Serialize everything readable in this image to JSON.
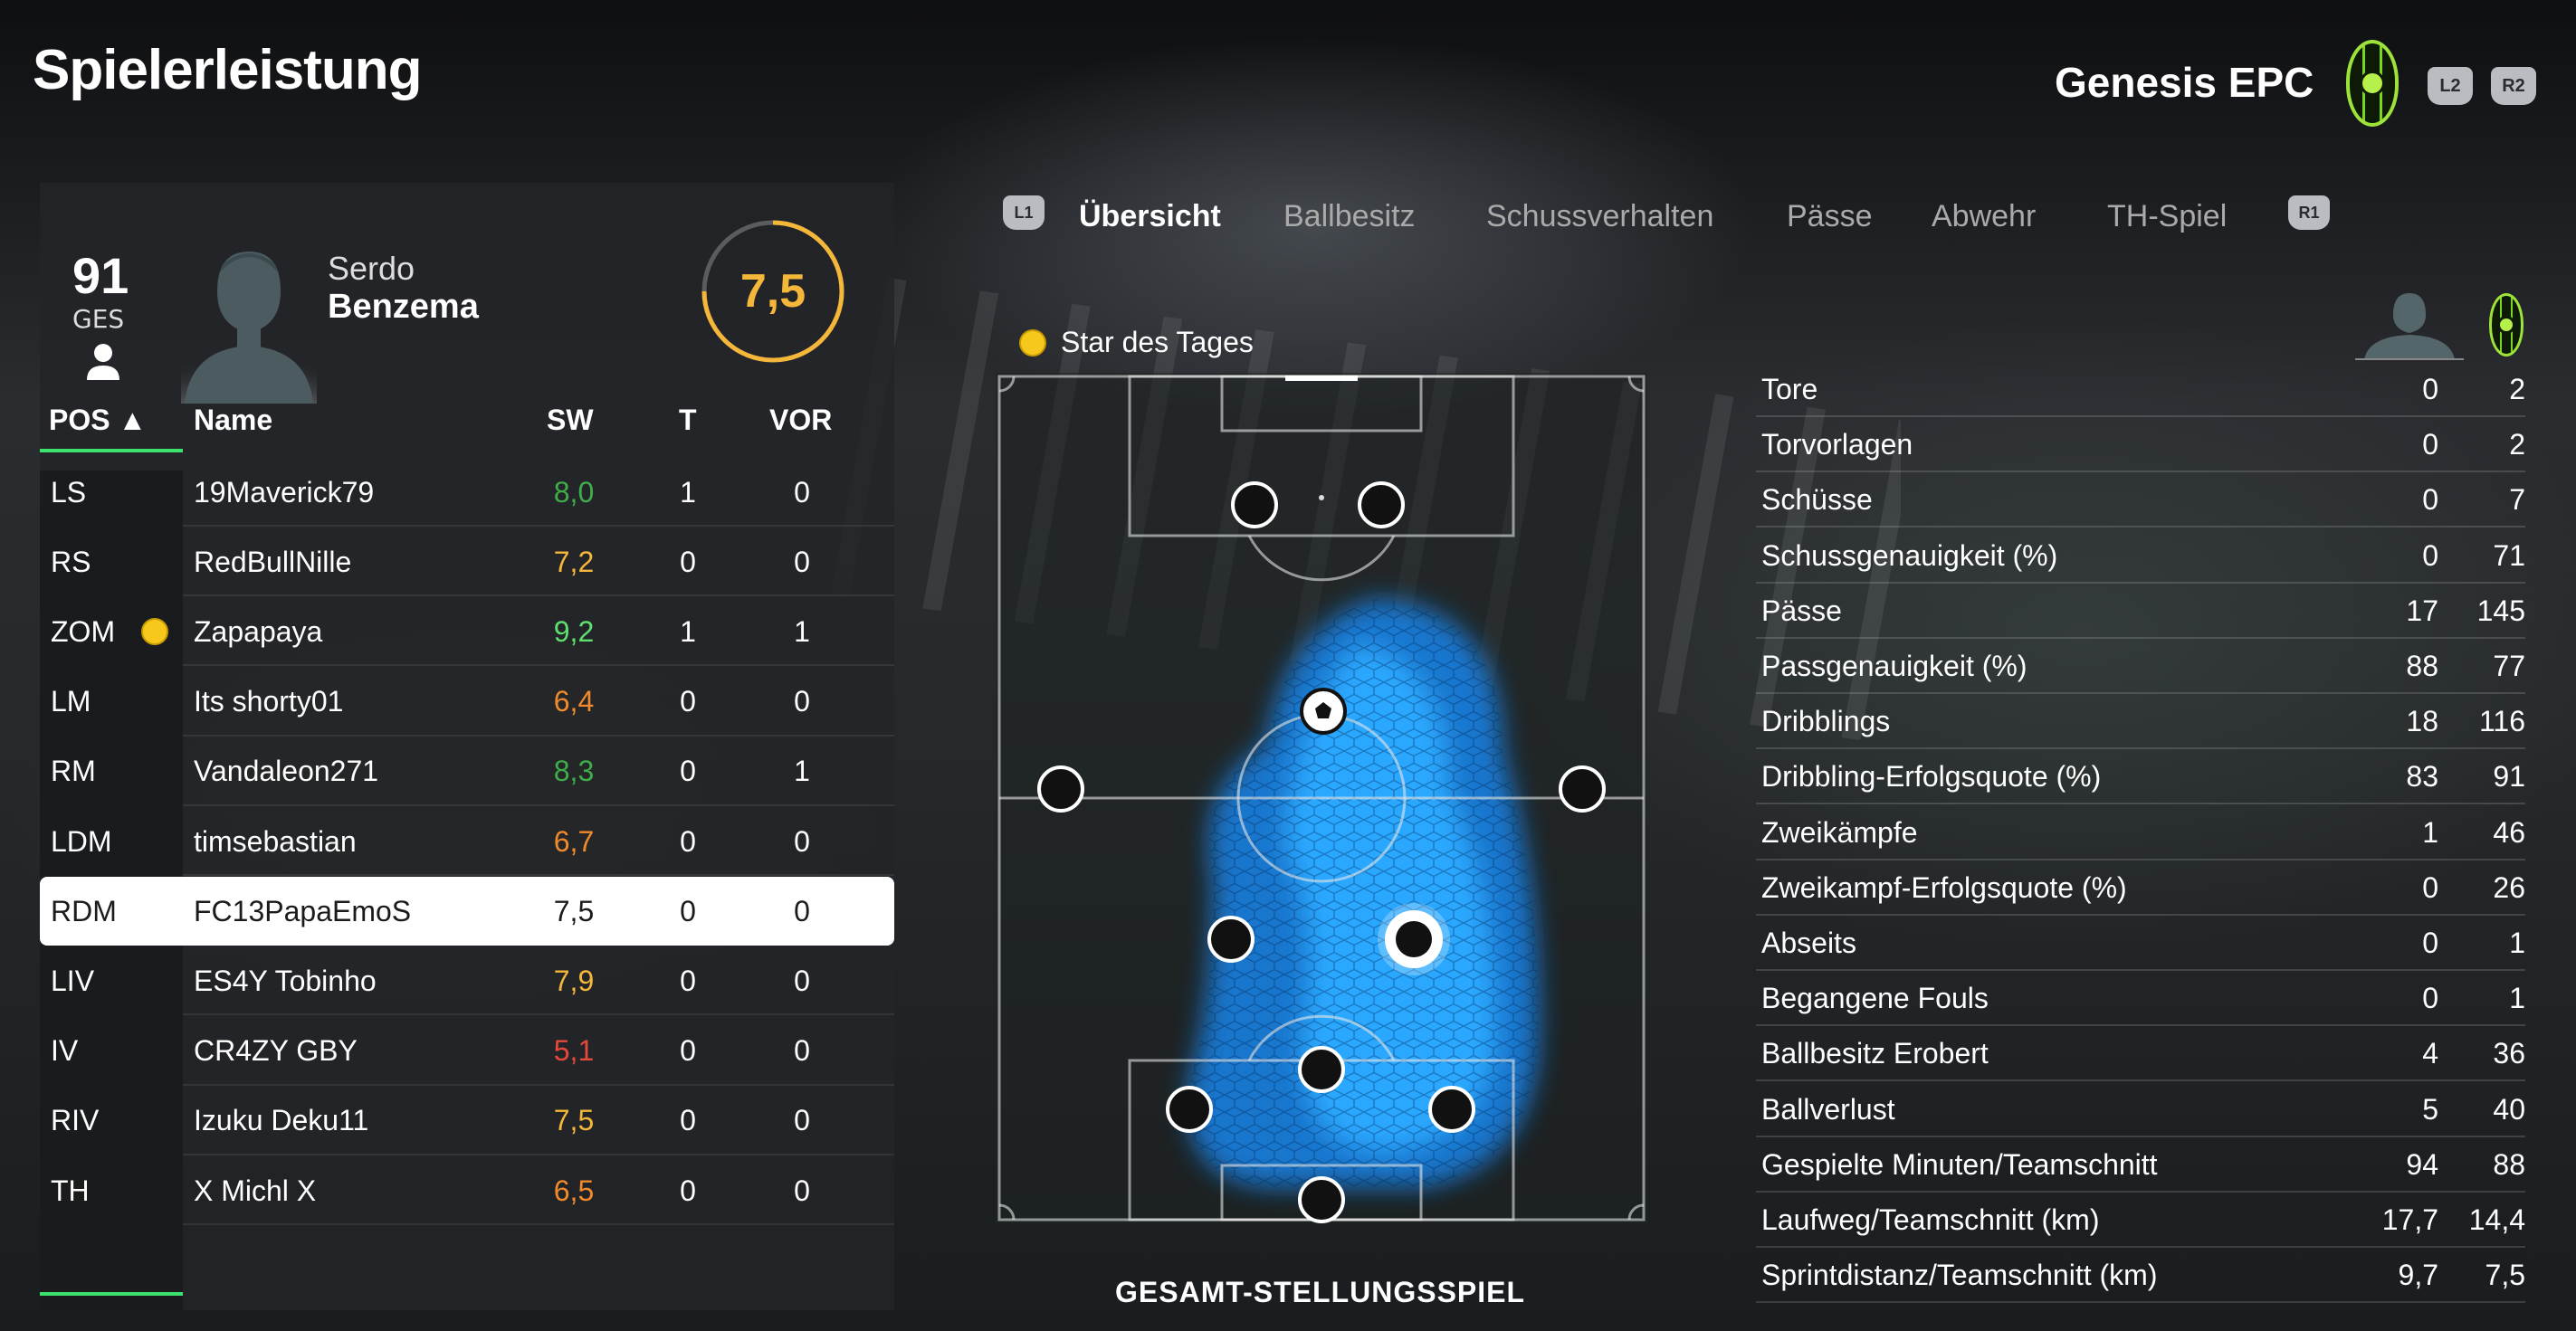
{
  "header": {
    "title": "Spielerleistung",
    "team_name": "Genesis EPC",
    "btn_l2": "L2",
    "btn_r2": "R2"
  },
  "player_card": {
    "overall": "91",
    "overall_label": "GES",
    "first_name": "Serdo",
    "last_name": "Benzema",
    "rating": "7,5",
    "rating_fraction": 0.75
  },
  "table": {
    "headers": {
      "pos": "POS ▲",
      "name": "Name",
      "sw": "SW",
      "t": "T",
      "vor": "VOR"
    },
    "rows": [
      {
        "pos": "LS",
        "name": "19Maverick79",
        "sw": "8,0",
        "t": "1",
        "vor": "0",
        "color": "#3fae4a"
      },
      {
        "pos": "RS",
        "name": "RedBullNille",
        "sw": "7,2",
        "t": "0",
        "vor": "0",
        "color": "#f4b73a"
      },
      {
        "pos": "ZOM",
        "name": "Zapapaya",
        "sw": "9,2",
        "t": "1",
        "vor": "1",
        "color": "#5ee06f",
        "star": true
      },
      {
        "pos": "LM",
        "name": "Its shorty01",
        "sw": "6,4",
        "t": "0",
        "vor": "0",
        "color": "#f08a2c"
      },
      {
        "pos": "RM",
        "name": "Vandaleon271",
        "sw": "8,3",
        "t": "0",
        "vor": "1",
        "color": "#3fae4a"
      },
      {
        "pos": "LDM",
        "name": "timsebastian",
        "sw": "6,7",
        "t": "0",
        "vor": "0",
        "color": "#f08a2c"
      },
      {
        "pos": "RDM",
        "name": "FC13PapaEmoS",
        "sw": "7,5",
        "t": "0",
        "vor": "0",
        "color": "#1b1b1b",
        "selected": true
      },
      {
        "pos": "LIV",
        "name": "ES4Y Tobinho",
        "sw": "7,9",
        "t": "0",
        "vor": "0",
        "color": "#f4b73a"
      },
      {
        "pos": "IV",
        "name": "CR4ZY GBY",
        "sw": "5,1",
        "t": "0",
        "vor": "0",
        "color": "#e6483a"
      },
      {
        "pos": "RIV",
        "name": "Izuku Deku11",
        "sw": "7,5",
        "t": "0",
        "vor": "0",
        "color": "#f4b73a"
      },
      {
        "pos": "TH",
        "name": "X  Michl  X",
        "sw": "6,5",
        "t": "0",
        "vor": "0",
        "color": "#f08a2c"
      }
    ]
  },
  "tabs": {
    "l1": "L1",
    "r1": "R1",
    "items": [
      "Übersicht",
      "Ballbesitz",
      "Schussverhalten",
      "Pässe",
      "Abwehr",
      "TH-Spiel"
    ],
    "active": 0
  },
  "pitch": {
    "star_label": "Star des Tages",
    "caption": "GESAMT-STELLUNGSSPIEL"
  },
  "stats": [
    {
      "label": "Tore",
      "player": "0",
      "team": "2"
    },
    {
      "label": "Torvorlagen",
      "player": "0",
      "team": "2"
    },
    {
      "label": "Schüsse",
      "player": "0",
      "team": "7"
    },
    {
      "label": "Schussgenauigkeit (%)",
      "player": "0",
      "team": "71"
    },
    {
      "label": "Pässe",
      "player": "17",
      "team": "145"
    },
    {
      "label": "Passgenauigkeit (%)",
      "player": "88",
      "team": "77"
    },
    {
      "label": "Dribblings",
      "player": "18",
      "team": "116"
    },
    {
      "label": "Dribbling-Erfolgsquote (%)",
      "player": "83",
      "team": "91"
    },
    {
      "label": "Zweikämpfe",
      "player": "1",
      "team": "46"
    },
    {
      "label": "Zweikampf-Erfolgsquote (%)",
      "player": "0",
      "team": "26"
    },
    {
      "label": "Abseits",
      "player": "0",
      "team": "1"
    },
    {
      "label": "Begangene Fouls",
      "player": "0",
      "team": "1"
    },
    {
      "label": "Ballbesitz Erobert",
      "player": "4",
      "team": "36"
    },
    {
      "label": "Ballverlust",
      "player": "5",
      "team": "40"
    },
    {
      "label": "Gespielte Minuten/Teamschnitt",
      "player": "94",
      "team": "88"
    },
    {
      "label": "Laufweg/Teamschnitt (km)",
      "player": "17,7",
      "team": "14,4"
    },
    {
      "label": "Sprintdistanz/Teamschnitt (km)",
      "player": "9,7",
      "team": "7,5"
    }
  ],
  "colors": {
    "accent_green": "#3ce26e",
    "rating_gold": "#f4b73a",
    "heat_blue": "#1ea0ff"
  }
}
